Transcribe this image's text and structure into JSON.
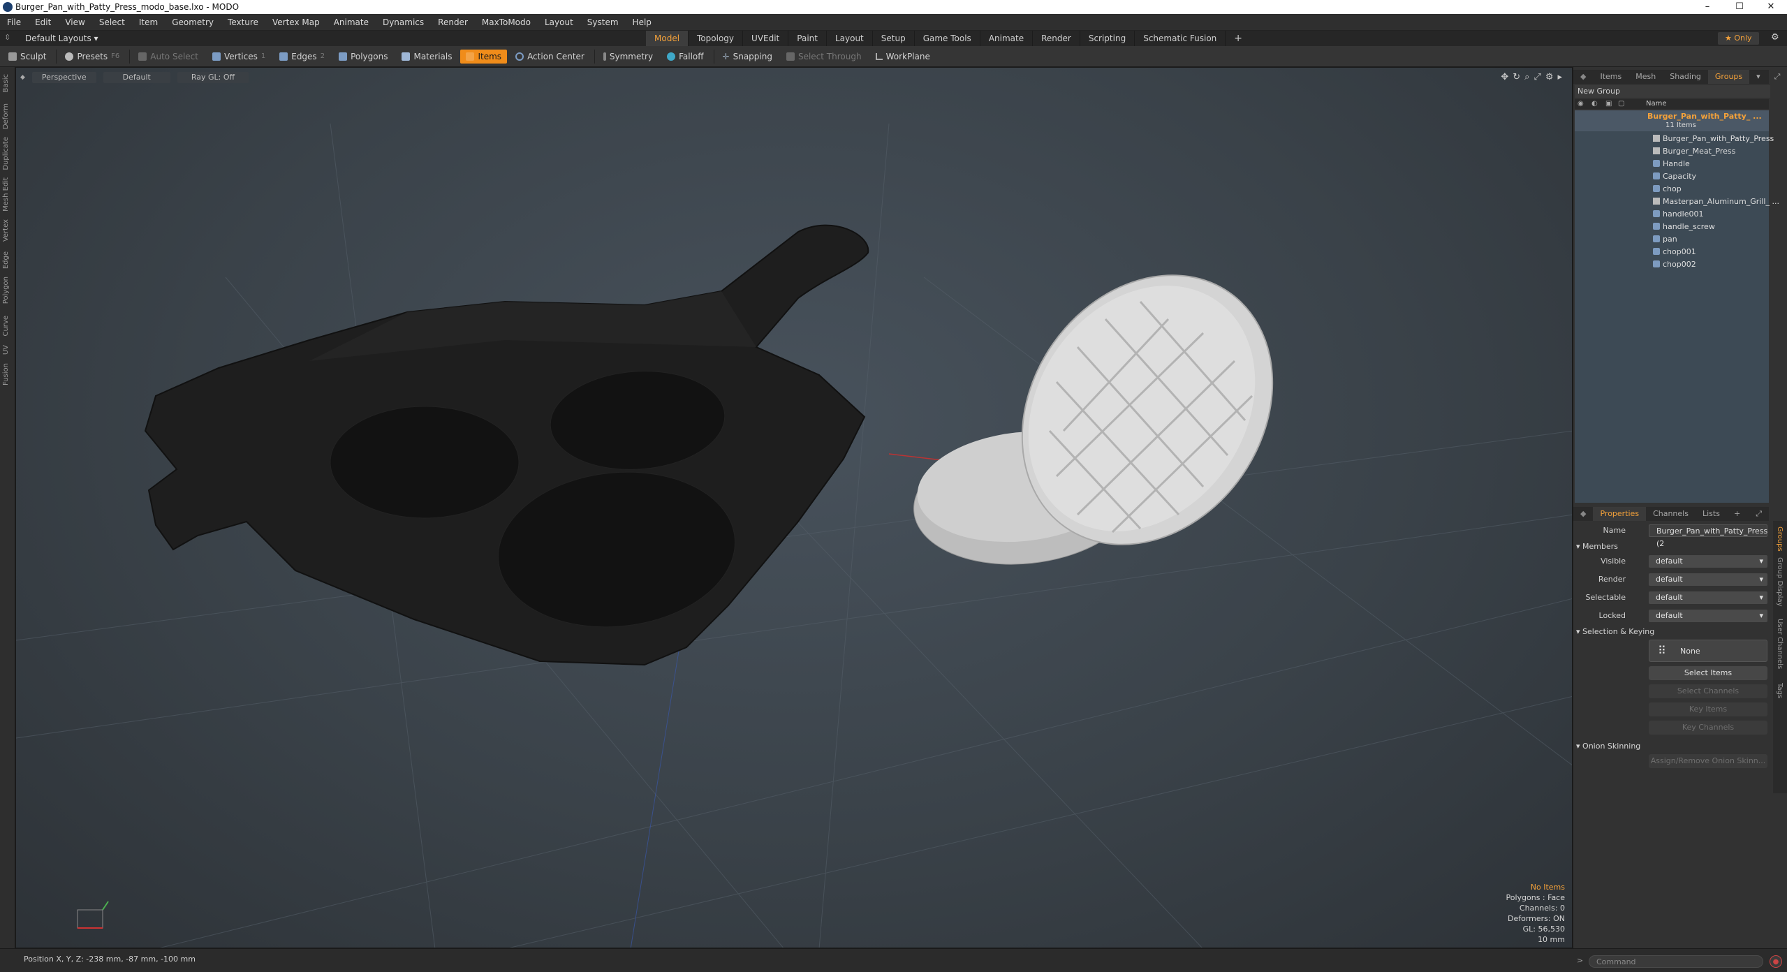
{
  "window": {
    "title": "Burger_Pan_with_Patty_Press_modo_base.lxo - MODO",
    "controls": [
      "–",
      "☐",
      "✕"
    ]
  },
  "menu": [
    "File",
    "Edit",
    "View",
    "Select",
    "Item",
    "Geometry",
    "Texture",
    "Vertex Map",
    "Animate",
    "Dynamics",
    "Render",
    "MaxToModo",
    "Layout",
    "System",
    "Help"
  ],
  "layout_bar": {
    "layouts_label": "Default Layouts ▾",
    "tabs": [
      "Model",
      "Topology",
      "UVEdit",
      "Paint",
      "Layout",
      "Setup",
      "Game Tools",
      "Animate",
      "Render",
      "Scripting",
      "Schematic Fusion"
    ],
    "active_tab": "Model",
    "add": "+",
    "only_label": "★  Only"
  },
  "toolbar": {
    "sculpt": "Sculpt",
    "presets": "Presets",
    "presets_key": "F6",
    "auto_select": "Auto Select",
    "vertices": "Vertices",
    "vertices_key": "1",
    "edges": "Edges",
    "edges_key": "2",
    "polygons": "Polygons",
    "materials": "Materials",
    "items": "Items",
    "action_center": "Action Center",
    "symmetry": "Symmetry",
    "falloff": "Falloff",
    "snapping": "Snapping",
    "select_through": "Select Through",
    "workplane": "WorkPlane"
  },
  "left_strip": [
    "Basic",
    "Deform",
    "Duplicate",
    "Mesh Edit",
    "Vertex",
    "Edge",
    "Polygon",
    "Curve",
    "UV",
    "Fusion"
  ],
  "viewport": {
    "view_mode": "Perspective",
    "shading": "Default",
    "raygl": "Ray GL: Off",
    "info": {
      "selection": "No Items",
      "polygons": "Polygons : Face",
      "channels": "Channels: 0",
      "deformers": "Deformers: ON",
      "gl": "GL: 56,530",
      "grid": "10 mm"
    }
  },
  "status": {
    "position": "Position X, Y, Z:  -238 mm, -87 mm, -100 mm",
    "command_placeholder": "Command"
  },
  "item_panel": {
    "tabs": [
      "Items",
      "Mesh ...",
      "Shading",
      "Groups"
    ],
    "active_tab": "Groups",
    "new_group": "New Group",
    "name_header": "Name",
    "group_name": "Burger_Pan_with_Patty_ ...",
    "group_count": "11 Items",
    "items": [
      "Burger_Pan_with_Patty_Press",
      "Burger_Meat_Press",
      "Handle",
      "Capacity",
      "chop",
      "Masterpan_Aluminum_Grill_ ...",
      "handle001",
      "handle_screw",
      "pan",
      "chop001",
      "chop002"
    ]
  },
  "properties_panel": {
    "tabs": [
      "Properties",
      "Channels",
      "Lists",
      "+"
    ],
    "active_tab": "Properties",
    "side_tabs": [
      "Groups",
      "Group Display",
      "User Channels",
      "Tags"
    ],
    "name_label": "Name",
    "name_value": "Burger_Pan_with_Patty_Press (2",
    "members_section": "Members",
    "fields": [
      {
        "label": "Visible",
        "value": "default"
      },
      {
        "label": "Render",
        "value": "default"
      },
      {
        "label": "Selectable",
        "value": "default"
      },
      {
        "label": "Locked",
        "value": "default"
      }
    ],
    "selection_section": "Selection & Keying",
    "none_label": "None",
    "select_items": "Select Items",
    "select_channels": "Select Channels",
    "key_items": "Key Items",
    "key_channels": "Key Channels",
    "onion_section": "Onion Skinning",
    "onion_button": "Assign/Remove Onion Skinn..."
  },
  "colors": {
    "accent": "#f3a13a",
    "active_button": "#f08c1a",
    "viewport_bg": "#3a4249",
    "pan": "#1f1f1f",
    "press": "#d8d8d8"
  }
}
